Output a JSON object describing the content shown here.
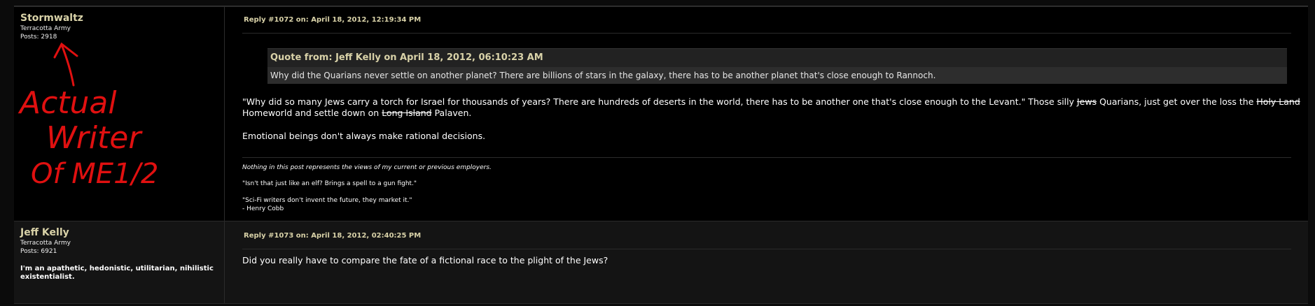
{
  "posts": [
    {
      "author": "Stormwaltz",
      "rank": "Terracotta Army",
      "posts": "Posts: 2918",
      "reply": "Reply #1072 on: April 18, 2012, 12:19:34 PM",
      "quote_header": "Quote from: Jeff Kelly on April 18, 2012, 06:10:23 AM",
      "quote_text": "Why did the Quarians never settle on another planet? There are billions of stars in the galaxy, there has to be another planet that's close enough to Rannoch.",
      "body": {
        "part1": "\"Why did so many Jews carry a torch for Israel for thousands of years? There are hundreds of deserts in the world, there has to be another one that's close enough to the Levant.\" Those silly ",
        "strike1": "Jews",
        "part2": " Quarians, just get over the loss the ",
        "strike2": "Holy Land",
        "part3": " Homeworld and settle down on ",
        "strike3": "Long Island",
        "part4": " Palaven.",
        "para2": "Emotional beings don't always make rational decisions."
      },
      "signature": {
        "line1": "Nothing in this post represents the views of my current or previous employers.",
        "line2": "\"Isn't that just like an elf? Brings a spell to a gun fight.\"",
        "line3": "\"Sci-Fi writers don't invent the future, they market it.\"",
        "line4": "- Henry Cobb"
      },
      "annotation": {
        "line1": "Actual",
        "line2": "Writer",
        "line3": "Of ME1/2",
        "color": "#e01010"
      }
    },
    {
      "author": "Jeff Kelly",
      "rank": "Terracotta Army",
      "posts": "Posts: 6921",
      "personal_text": "I'm an apathetic, hedonistic, utilitarian, nihilistic existentialist.",
      "reply": "Reply #1073 on: April 18, 2012, 02:40:25 PM",
      "body": "Did you really have to compare the fate of a fictional race to the plight of the Jews?"
    }
  ],
  "colors": {
    "background": "#000000",
    "alt_background": "#141414",
    "name_color": "#d9d2a8",
    "quote_bg": "#2d2d2d"
  }
}
